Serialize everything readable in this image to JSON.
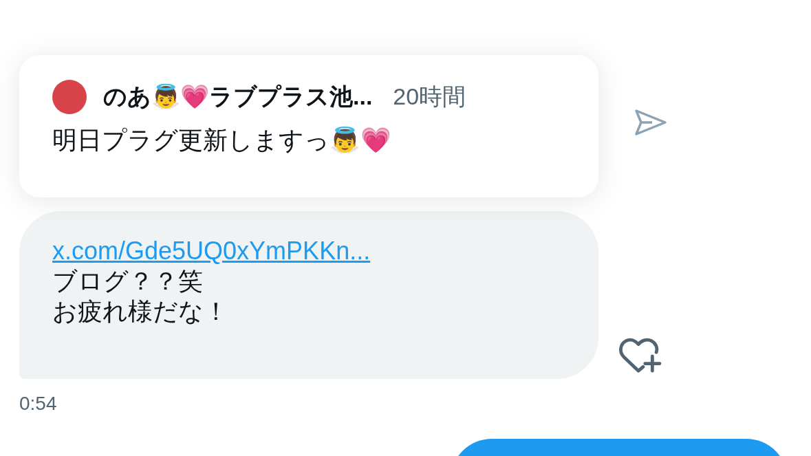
{
  "quoted_message": {
    "author": "のあ👼💗ラブプラス池...",
    "time": "20時間",
    "text": "明日プラグ更新しますっ👼💗"
  },
  "message": {
    "link": "x.com/Gde5UQ0xYmPKKn...",
    "lines": [
      "ブログ？？笑",
      "お疲れ様だな！"
    ],
    "time": "0:54"
  }
}
